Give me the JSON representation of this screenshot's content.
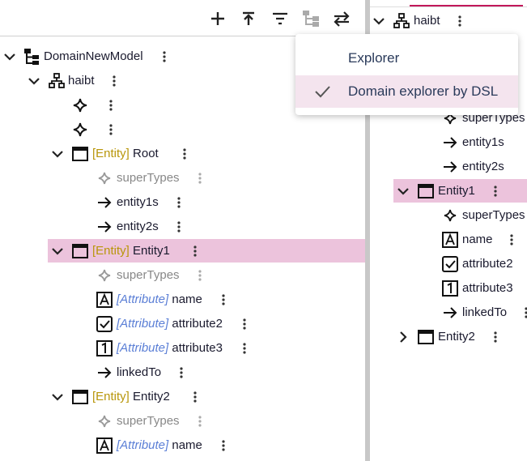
{
  "toolbar": {
    "buttons": [
      {
        "name": "add-icon"
      },
      {
        "name": "collapse-all-icon"
      },
      {
        "name": "filter-icon"
      },
      {
        "name": "hierarchy-icon"
      },
      {
        "name": "swap-icon"
      }
    ]
  },
  "left_tree": {
    "root": "DomainNewModel",
    "package": "haibt",
    "entities": [
      {
        "tag": "[Entity]",
        "name": "Root",
        "children": [
          "superTypes",
          "entity1s",
          "entity2s"
        ]
      },
      {
        "tag": "[Entity]",
        "name": "Entity1",
        "children": [
          "superTypes"
        ],
        "attributes": [
          {
            "tag": "[Attribute]",
            "name": "name"
          },
          {
            "tag": "[Attribute]",
            "name": "attribute2"
          },
          {
            "tag": "[Attribute]",
            "name": "attribute3"
          }
        ],
        "ref": "linkedTo"
      },
      {
        "tag": "[Entity]",
        "name": "Entity2",
        "children": [
          "superTypes"
        ],
        "attributes": [
          {
            "tag": "[Attribute]",
            "name": "name"
          }
        ]
      }
    ]
  },
  "right_tree": {
    "package": "haibt",
    "root_children": [
      "superTypes",
      "entity1s",
      "entity2s"
    ],
    "entity1": "Entity1",
    "entity1_children": [
      "superTypes",
      "name",
      "attribute2",
      "attribute3",
      "linkedTo"
    ],
    "entity2": "Entity2"
  },
  "menu": {
    "items": [
      {
        "label": "Explorer",
        "checked": false
      },
      {
        "label": "Domain explorer by DSL",
        "checked": true
      }
    ]
  },
  "colors": {
    "selection": "#ecc3dc",
    "entity_tag": "#b8960a",
    "attr_tag": "#5b7fd6",
    "menu_selected": "#f4e4ee"
  }
}
